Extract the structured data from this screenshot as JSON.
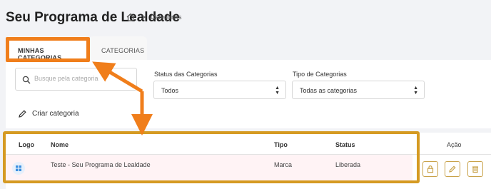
{
  "header": {
    "title": "Seu Programa de Lealdade",
    "breadcrumb_separator": ">",
    "breadcrumb_current": "Categorias"
  },
  "tabs": [
    {
      "label": "MINHAS CATEGORIAS",
      "active": true
    },
    {
      "label": "CATEGORIAS",
      "active": false
    }
  ],
  "filters": {
    "search_placeholder": "Busque pela categoria",
    "status_label": "Status das Categorias",
    "status_value": "Todos",
    "type_label": "Tipo de Categorias",
    "type_value": "Todas as categorias"
  },
  "create_label": "Criar categoria",
  "table": {
    "columns": [
      "Logo",
      "Nome",
      "Tipo",
      "Status",
      "Ação"
    ],
    "rows": [
      {
        "nome": "Teste - Seu Programa de Lealdade",
        "tipo": "Marca",
        "status": "Liberada"
      }
    ]
  },
  "icons": {
    "home": "home-icon",
    "search": "search-icon",
    "pencil": "pencil-icon",
    "logo": "grid-logo-icon",
    "lock": "lock-icon",
    "edit": "edit-icon",
    "trash": "trash-icon"
  },
  "colors": {
    "highlight_orange": "#f07e1b",
    "highlight_gold": "#d59a22",
    "action_border": "#c9a24a",
    "row_highlight": "#fff3f5"
  }
}
